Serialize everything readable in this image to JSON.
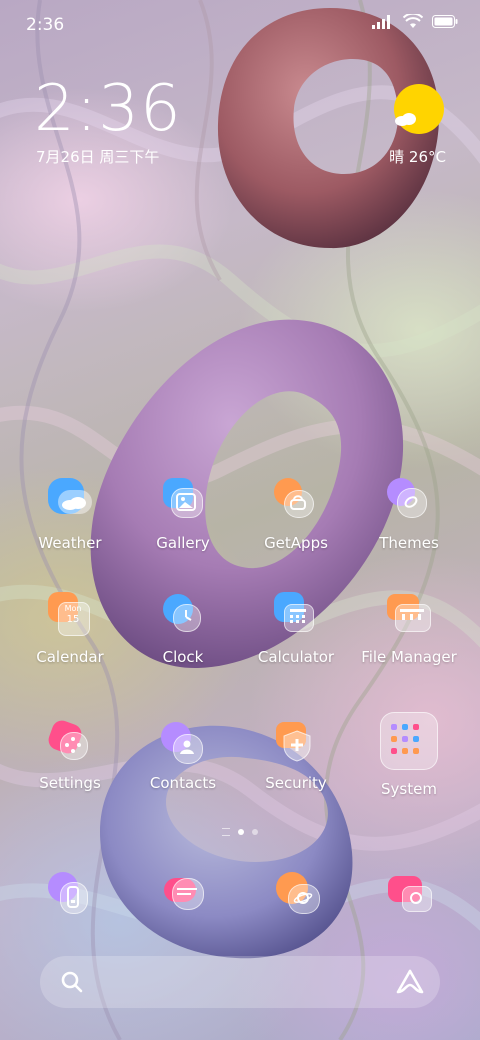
{
  "status_bar": {
    "time": "2:36",
    "icons": [
      "signal-icon",
      "wifi-icon",
      "battery-icon"
    ]
  },
  "clock": {
    "time": "2:36",
    "date": "7月26日 周三下午"
  },
  "weather": {
    "text": "晴 26°C",
    "sun_color": "#ffd400"
  },
  "apps": [
    {
      "label": "Weather",
      "icon": "weather-icon"
    },
    {
      "label": "Gallery",
      "icon": "gallery-icon"
    },
    {
      "label": "GetApps",
      "icon": "getapps-icon"
    },
    {
      "label": "Themes",
      "icon": "themes-icon"
    },
    {
      "label": "Calendar",
      "icon": "calendar-icon",
      "icon_text": "Mon 15"
    },
    {
      "label": "Clock",
      "icon": "clock-icon"
    },
    {
      "label": "Calculator",
      "icon": "calculator-icon"
    },
    {
      "label": "File Manager",
      "icon": "file-manager-icon"
    },
    {
      "label": "Settings",
      "icon": "settings-icon"
    },
    {
      "label": "Contacts",
      "icon": "contacts-icon"
    },
    {
      "label": "Security",
      "icon": "security-icon"
    },
    {
      "label": "System",
      "icon": "system-folder-icon"
    }
  ],
  "calendar_icon": {
    "day": "Mon",
    "date": "15"
  },
  "dock": [
    {
      "icon": "phone-icon"
    },
    {
      "icon": "messages-icon"
    },
    {
      "icon": "browser-icon"
    },
    {
      "icon": "camera-icon"
    }
  ],
  "page_indicator": {
    "pages": 2,
    "current": 1
  },
  "colors": {
    "blue": "#4aa8ff",
    "orange": "#ff9a50",
    "purple": "#b58cff",
    "pink": "#ff4f8b"
  }
}
